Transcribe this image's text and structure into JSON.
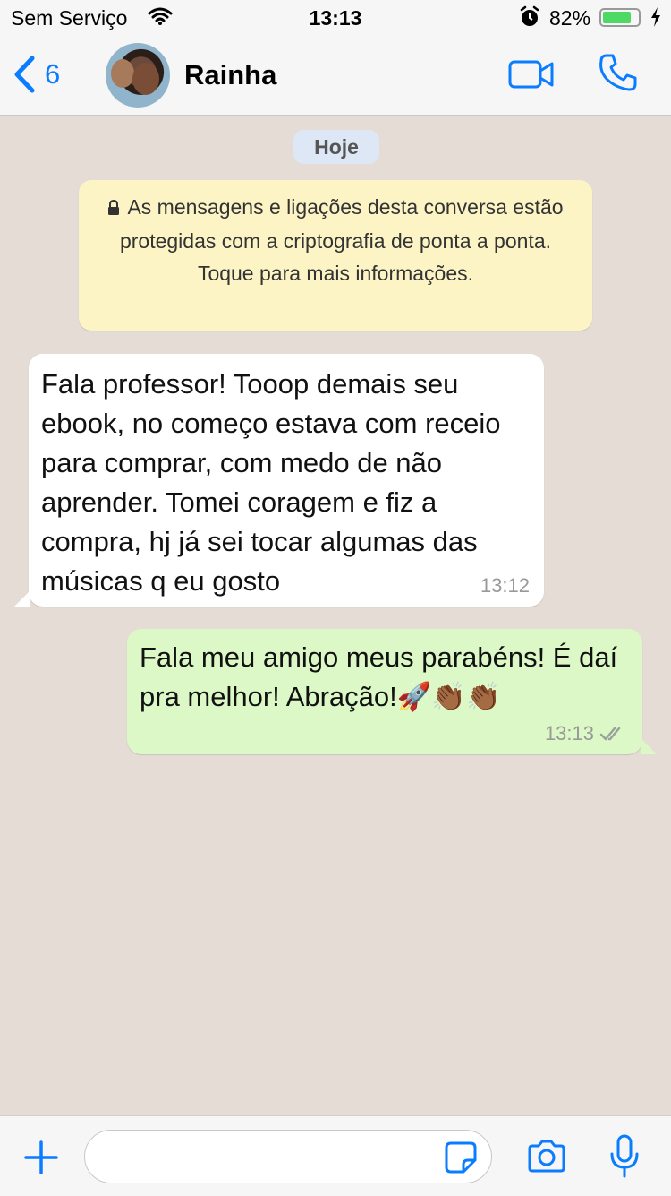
{
  "status_bar": {
    "carrier": "Sem Serviço",
    "time": "13:13",
    "battery_percent": "82%",
    "battery_level": 0.82
  },
  "header": {
    "back_count": "6",
    "contact_name": "Rainha"
  },
  "chat": {
    "date_label": "Hoje",
    "encryption_notice": "As mensagens e ligações desta conversa estão protegidas com a criptografia de ponta a ponta. Toque para mais informações.",
    "messages": [
      {
        "direction": "incoming",
        "text": "Fala professor! Tooop demais seu ebook, no começo estava com receio para comprar, com medo de não aprender. Tomei coragem e fiz a compra, hj já sei tocar algumas das músicas q eu gosto",
        "time": "13:12"
      },
      {
        "direction": "outgoing",
        "text": "Fala meu amigo meus parabéns! É daí pra melhor! Abração!🚀👏🏾👏🏾",
        "time": "13:13",
        "status": "read"
      }
    ]
  },
  "input": {
    "placeholder": ""
  },
  "colors": {
    "accent": "#0a7cff",
    "incoming_bubble": "#ffffff",
    "outgoing_bubble": "#dcf8c6",
    "notice_bubble": "#fdf4c5",
    "chat_background": "#e5ddd5",
    "battery_fill": "#4cd964"
  }
}
